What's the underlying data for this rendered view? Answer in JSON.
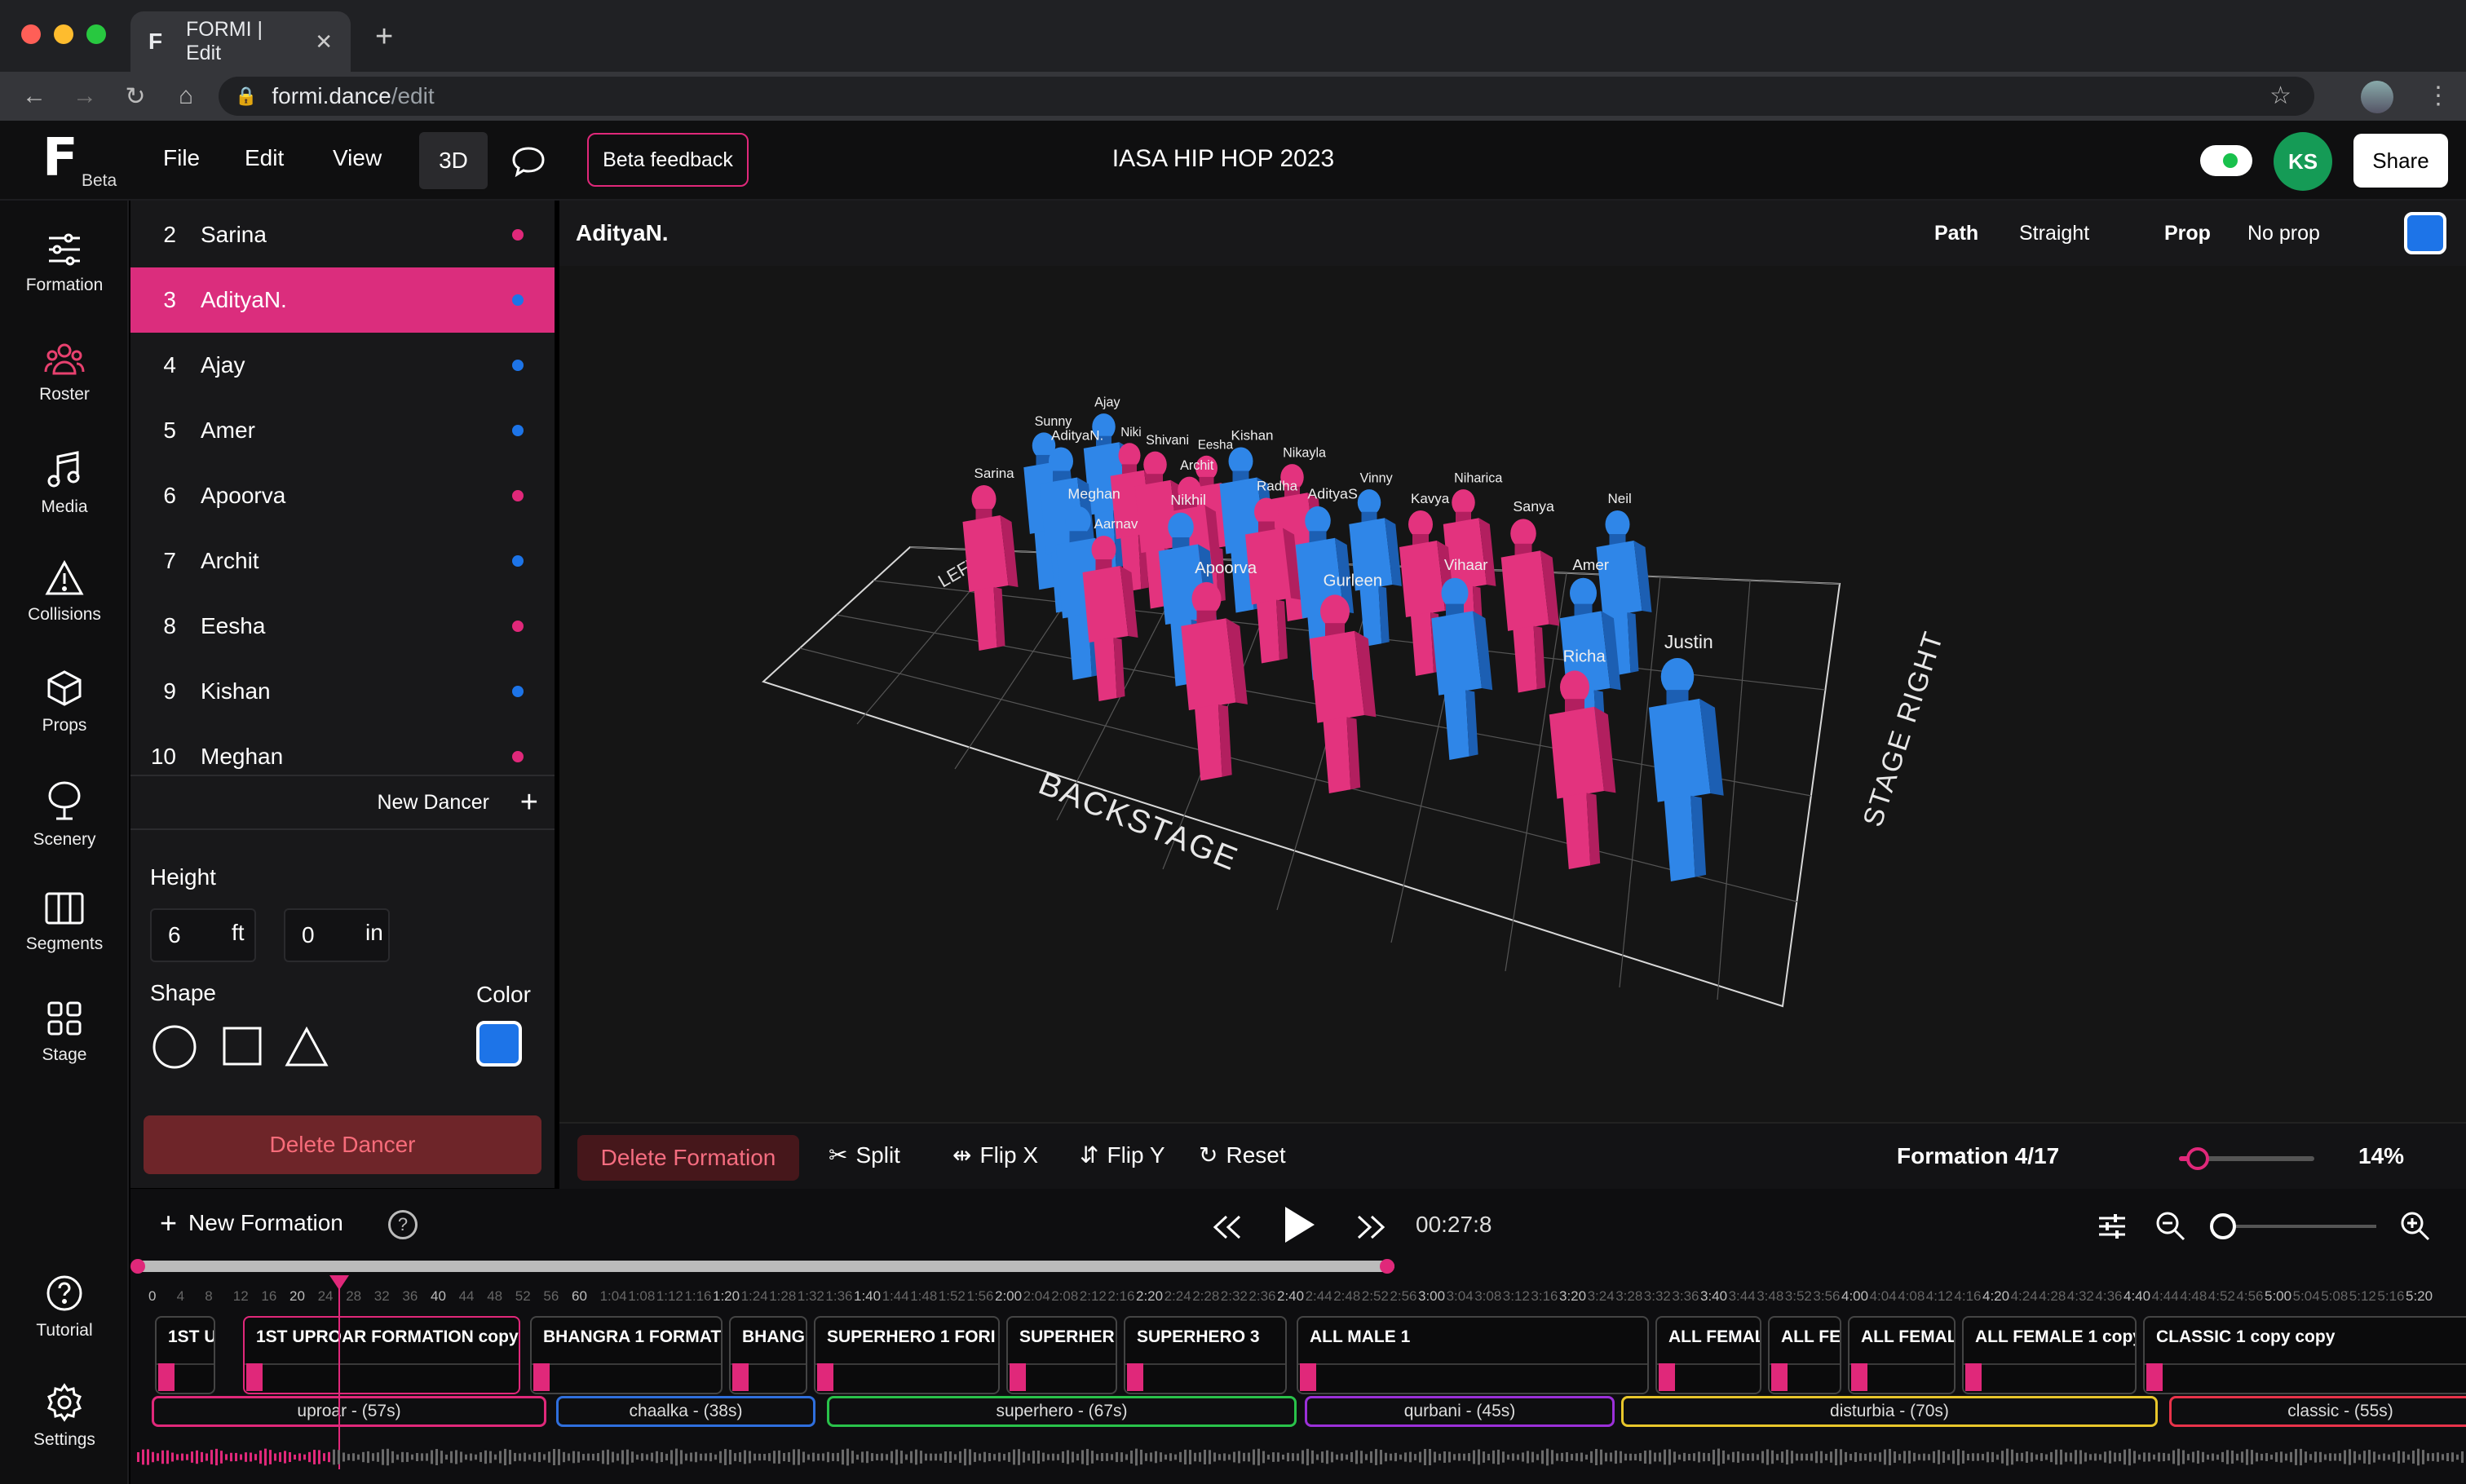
{
  "browser": {
    "tab_title": "FORMI | Edit",
    "url_host": "formi.dance",
    "url_path": "/edit"
  },
  "header": {
    "beta": "Beta",
    "menu": [
      "File",
      "Edit",
      "View"
    ],
    "btn_3d": "3D",
    "beta_feedback": "Beta feedback",
    "title": "IASA HIP HOP 2023",
    "avatar": "KS",
    "share": "Share"
  },
  "left_nav": {
    "items": [
      {
        "label": "Formation",
        "icon": "sliders-icon"
      },
      {
        "label": "Roster",
        "icon": "people-icon"
      },
      {
        "label": "Media",
        "icon": "music-icon"
      },
      {
        "label": "Collisions",
        "icon": "warning-icon"
      },
      {
        "label": "Props",
        "icon": "cube-icon"
      },
      {
        "label": "Scenery",
        "icon": "tree-icon"
      },
      {
        "label": "Segments",
        "icon": "columns-icon"
      },
      {
        "label": "Stage",
        "icon": "grid-icon"
      }
    ],
    "bottom": [
      {
        "label": "Tutorial",
        "icon": "help-icon"
      },
      {
        "label": "Settings",
        "icon": "gear-icon"
      }
    ]
  },
  "dancers": [
    {
      "num": "2",
      "name": "Sarina",
      "color": "#e0287a"
    },
    {
      "num": "3",
      "name": "AdityaN.",
      "color": "#1d74e8",
      "selected": true
    },
    {
      "num": "4",
      "name": "Ajay",
      "color": "#1d74e8"
    },
    {
      "num": "5",
      "name": "Amer",
      "color": "#1d74e8"
    },
    {
      "num": "6",
      "name": "Apoorva",
      "color": "#e0287a"
    },
    {
      "num": "7",
      "name": "Archit",
      "color": "#1d74e8"
    },
    {
      "num": "8",
      "name": "Eesha",
      "color": "#e0287a"
    },
    {
      "num": "9",
      "name": "Kishan",
      "color": "#1d74e8"
    },
    {
      "num": "10",
      "name": "Meghan",
      "color": "#e0287a"
    }
  ],
  "dancer_panel": {
    "new_dancer": "New Dancer",
    "height_label": "Height",
    "height_ft": "6",
    "ft_unit": "ft",
    "height_in": "0",
    "in_unit": "in",
    "shape_label": "Shape",
    "color_label": "Color",
    "delete": "Delete Dancer"
  },
  "viewport": {
    "selected_name": "AdityaN.",
    "path_label": "Path",
    "path_value": "Straight",
    "prop_label": "Prop",
    "prop_value": "No prop",
    "stage_labels": {
      "back": "BACKSTAGE",
      "right": "STAGE RIGHT",
      "left": "LEFT"
    },
    "figures": [
      {
        "name": "Sarina",
        "c": "p"
      },
      {
        "name": "Sunny",
        "c": "b"
      },
      {
        "name": "AdityaN.",
        "c": "b"
      },
      {
        "name": "Ajay",
        "c": "b"
      },
      {
        "name": "Niki",
        "c": "p"
      },
      {
        "name": "Shivani",
        "c": "p"
      },
      {
        "name": "Eesha",
        "c": "p"
      },
      {
        "name": "Kishan",
        "c": "b"
      },
      {
        "name": "Archit",
        "c": "p"
      },
      {
        "name": "Nikayla",
        "c": "p"
      },
      {
        "name": "Meghan",
        "c": "b"
      },
      {
        "name": "Aarnav",
        "c": "p"
      },
      {
        "name": "Nikhil",
        "c": "b"
      },
      {
        "name": "Radha",
        "c": "p"
      },
      {
        "name": "AdityaS",
        "c": "b"
      },
      {
        "name": "Vinny",
        "c": "b"
      },
      {
        "name": "Kavya",
        "c": "p"
      },
      {
        "name": "Niharica",
        "c": "p"
      },
      {
        "name": "Neil",
        "c": "b"
      },
      {
        "name": "Sanya",
        "c": "p"
      },
      {
        "name": "Vihaar",
        "c": "b"
      },
      {
        "name": "Amer",
        "c": "b"
      },
      {
        "name": "Apoorva",
        "c": "p"
      },
      {
        "name": "Gurleen",
        "c": "p"
      },
      {
        "name": "Richa",
        "c": "p"
      },
      {
        "name": "Justin",
        "c": "b"
      }
    ]
  },
  "formation_toolbar": {
    "delete": "Delete Formation",
    "split": "Split",
    "flip_x": "Flip X",
    "flip_y": "Flip Y",
    "reset": "Reset",
    "count": "Formation 4/17",
    "zoom_value": 0.14,
    "zoom": "14%"
  },
  "timeline": {
    "new_formation": "New Formation",
    "time": "00:27:8",
    "ruler": [
      "0",
      "4",
      "8",
      "12",
      "16",
      "20",
      "24",
      "28",
      "32",
      "36",
      "40",
      "44",
      "48",
      "52",
      "56",
      "60",
      "1:04",
      "1:08",
      "1:12",
      "1:16",
      "1:20",
      "1:24",
      "1:28",
      "1:32",
      "1:36",
      "1:40",
      "1:44",
      "1:48",
      "1:52",
      "1:56",
      "2:00",
      "2:04",
      "2:08",
      "2:12",
      "2:16",
      "2:20",
      "2:24",
      "2:28",
      "2:32",
      "2:36",
      "2:40",
      "2:44",
      "2:48",
      "2:52",
      "2:56",
      "3:00",
      "3:04",
      "3:08",
      "3:12",
      "3:16",
      "3:20",
      "3:24",
      "3:28",
      "3:32",
      "3:36",
      "3:40",
      "3:44",
      "3:48",
      "3:52",
      "3:56",
      "4:00",
      "4:04",
      "4:08",
      "4:12",
      "4:16",
      "4:20",
      "4:24",
      "4:28",
      "4:32",
      "4:36",
      "4:40",
      "4:44",
      "4:48",
      "4:52",
      "4:56",
      "5:00",
      "5:04",
      "5:08",
      "5:12",
      "5:16",
      "5:20"
    ],
    "formations": [
      {
        "title": "1ST U"
      },
      {
        "title": "1ST UPROAR FORMATION copy",
        "selected": true
      },
      {
        "title": "BHANGRA 1 FORMAT"
      },
      {
        "title": "BHANG"
      },
      {
        "title": "SUPERHERO 1 FORI"
      },
      {
        "title": "SUPERHER"
      },
      {
        "title": "SUPERHERO 3"
      },
      {
        "title": "ALL MALE 1"
      },
      {
        "title": "ALL FEMAL"
      },
      {
        "title": "ALL FEI"
      },
      {
        "title": "ALL FEMAL"
      },
      {
        "title": "ALL FEMALE 1 copy"
      },
      {
        "title": "CLASSIC 1 copy copy"
      }
    ],
    "segments": [
      {
        "label": "uproar - (57s)",
        "color": "#e0287a"
      },
      {
        "label": "chaalka - (38s)",
        "color": "#2f6fdd"
      },
      {
        "label": "superhero - (67s)",
        "color": "#29c24a"
      },
      {
        "label": "qurbani - (45s)",
        "color": "#9b30d9"
      },
      {
        "label": "disturbia - (70s)",
        "color": "#e8c62b"
      },
      {
        "label": "classic - (55s)",
        "color": "#e8334a"
      }
    ]
  }
}
